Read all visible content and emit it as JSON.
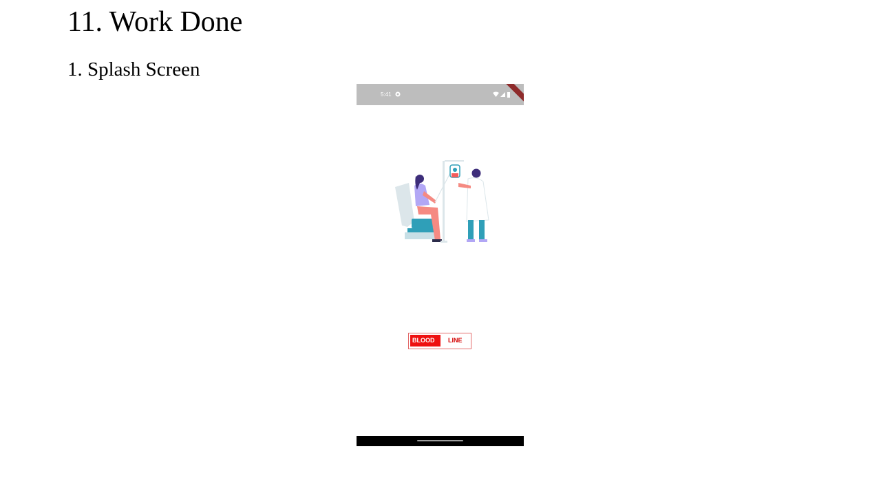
{
  "document": {
    "section_title": "11. Work Done",
    "subsection_title": "1. Splash Screen"
  },
  "screenshot": {
    "status_bar": {
      "time": "5:41",
      "icons": [
        "settings-icon",
        "wifi-icon",
        "signal-icon",
        "battery-icon"
      ]
    },
    "illustration": "blood-donation-illustration",
    "logo": {
      "left_text": "BLOOD",
      "right_text": "LINE"
    },
    "colors": {
      "status_bar": "#bdbdbd",
      "logo_red": "#ee1111",
      "debug_banner": "#8e2b2b",
      "nav_bar": "#000000"
    }
  }
}
